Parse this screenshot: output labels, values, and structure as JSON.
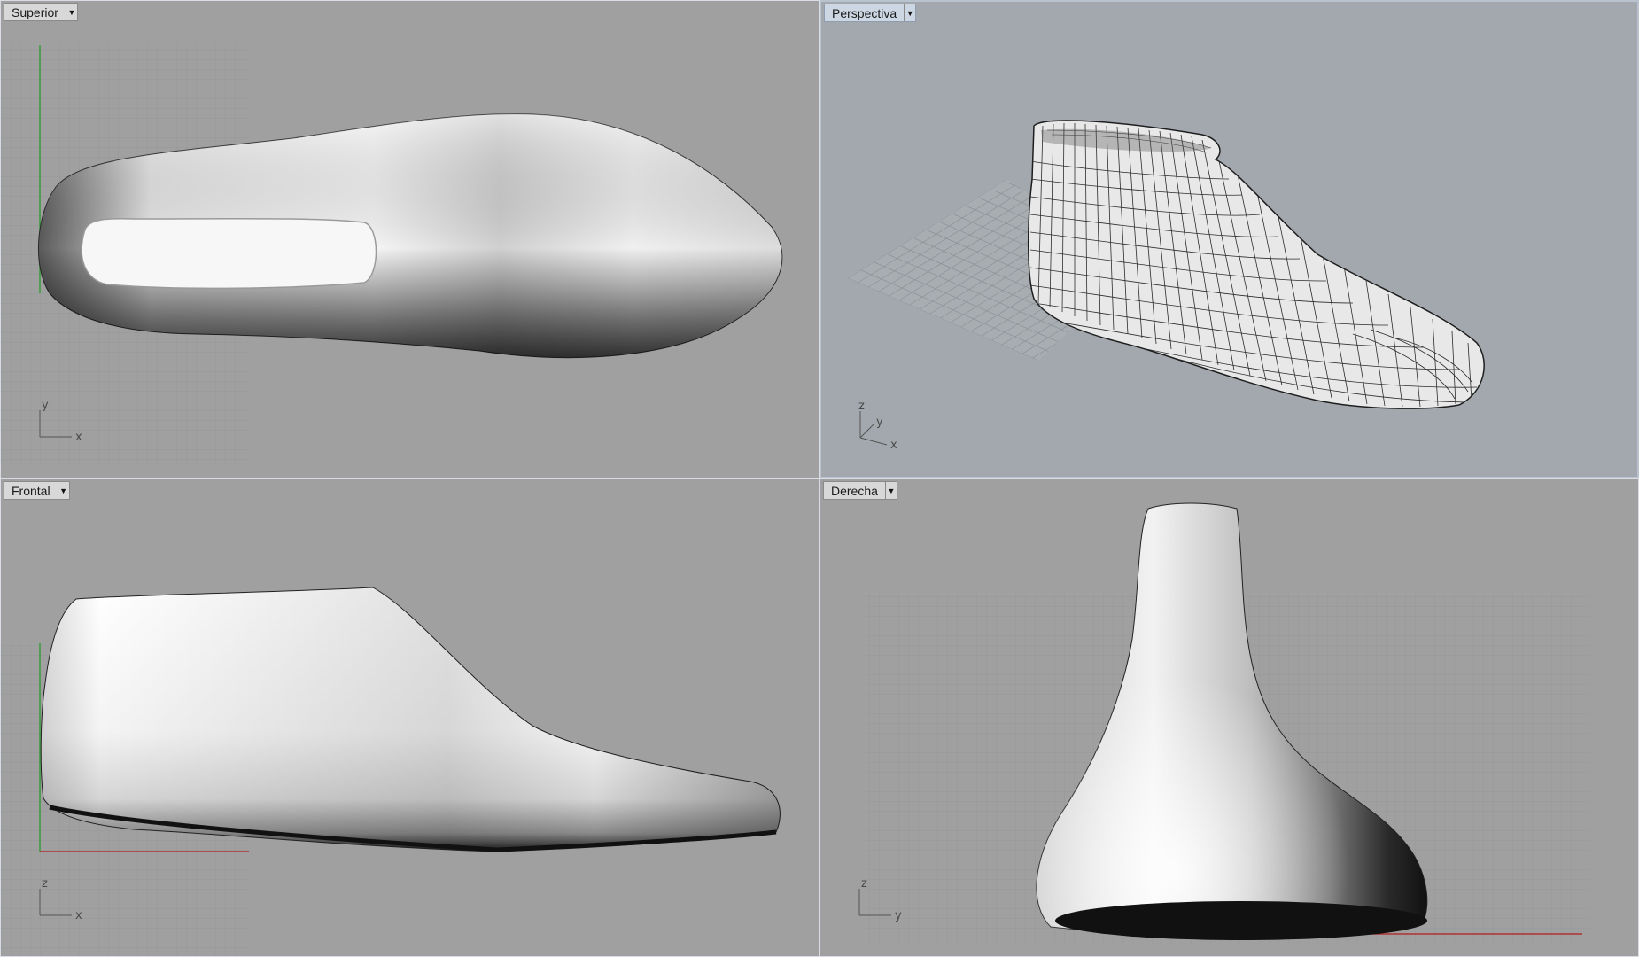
{
  "viewports": [
    {
      "id": "top",
      "label": "Superior",
      "active": false,
      "axis_h": "x",
      "axis_v": "y"
    },
    {
      "id": "perspective",
      "label": "Perspectiva",
      "active": true,
      "axis_h": "x",
      "axis_v": "z",
      "axis_d": "y"
    },
    {
      "id": "front",
      "label": "Frontal",
      "active": false,
      "axis_h": "x",
      "axis_v": "z"
    },
    {
      "id": "right",
      "label": "Derecha",
      "active": false,
      "axis_h": "y",
      "axis_v": "z"
    }
  ],
  "icons": {
    "viewport_menu": "dropdown-arrow-icon"
  },
  "colors": {
    "viewport_bg": "#a0a0a0",
    "active_viewport_bg": "#a3a8ae",
    "grid_line": "#8e9398",
    "x_axis": "#b03030",
    "y_axis": "#3a9a3a",
    "model": "#f2f2f2",
    "wire": "#2b2b2b"
  }
}
